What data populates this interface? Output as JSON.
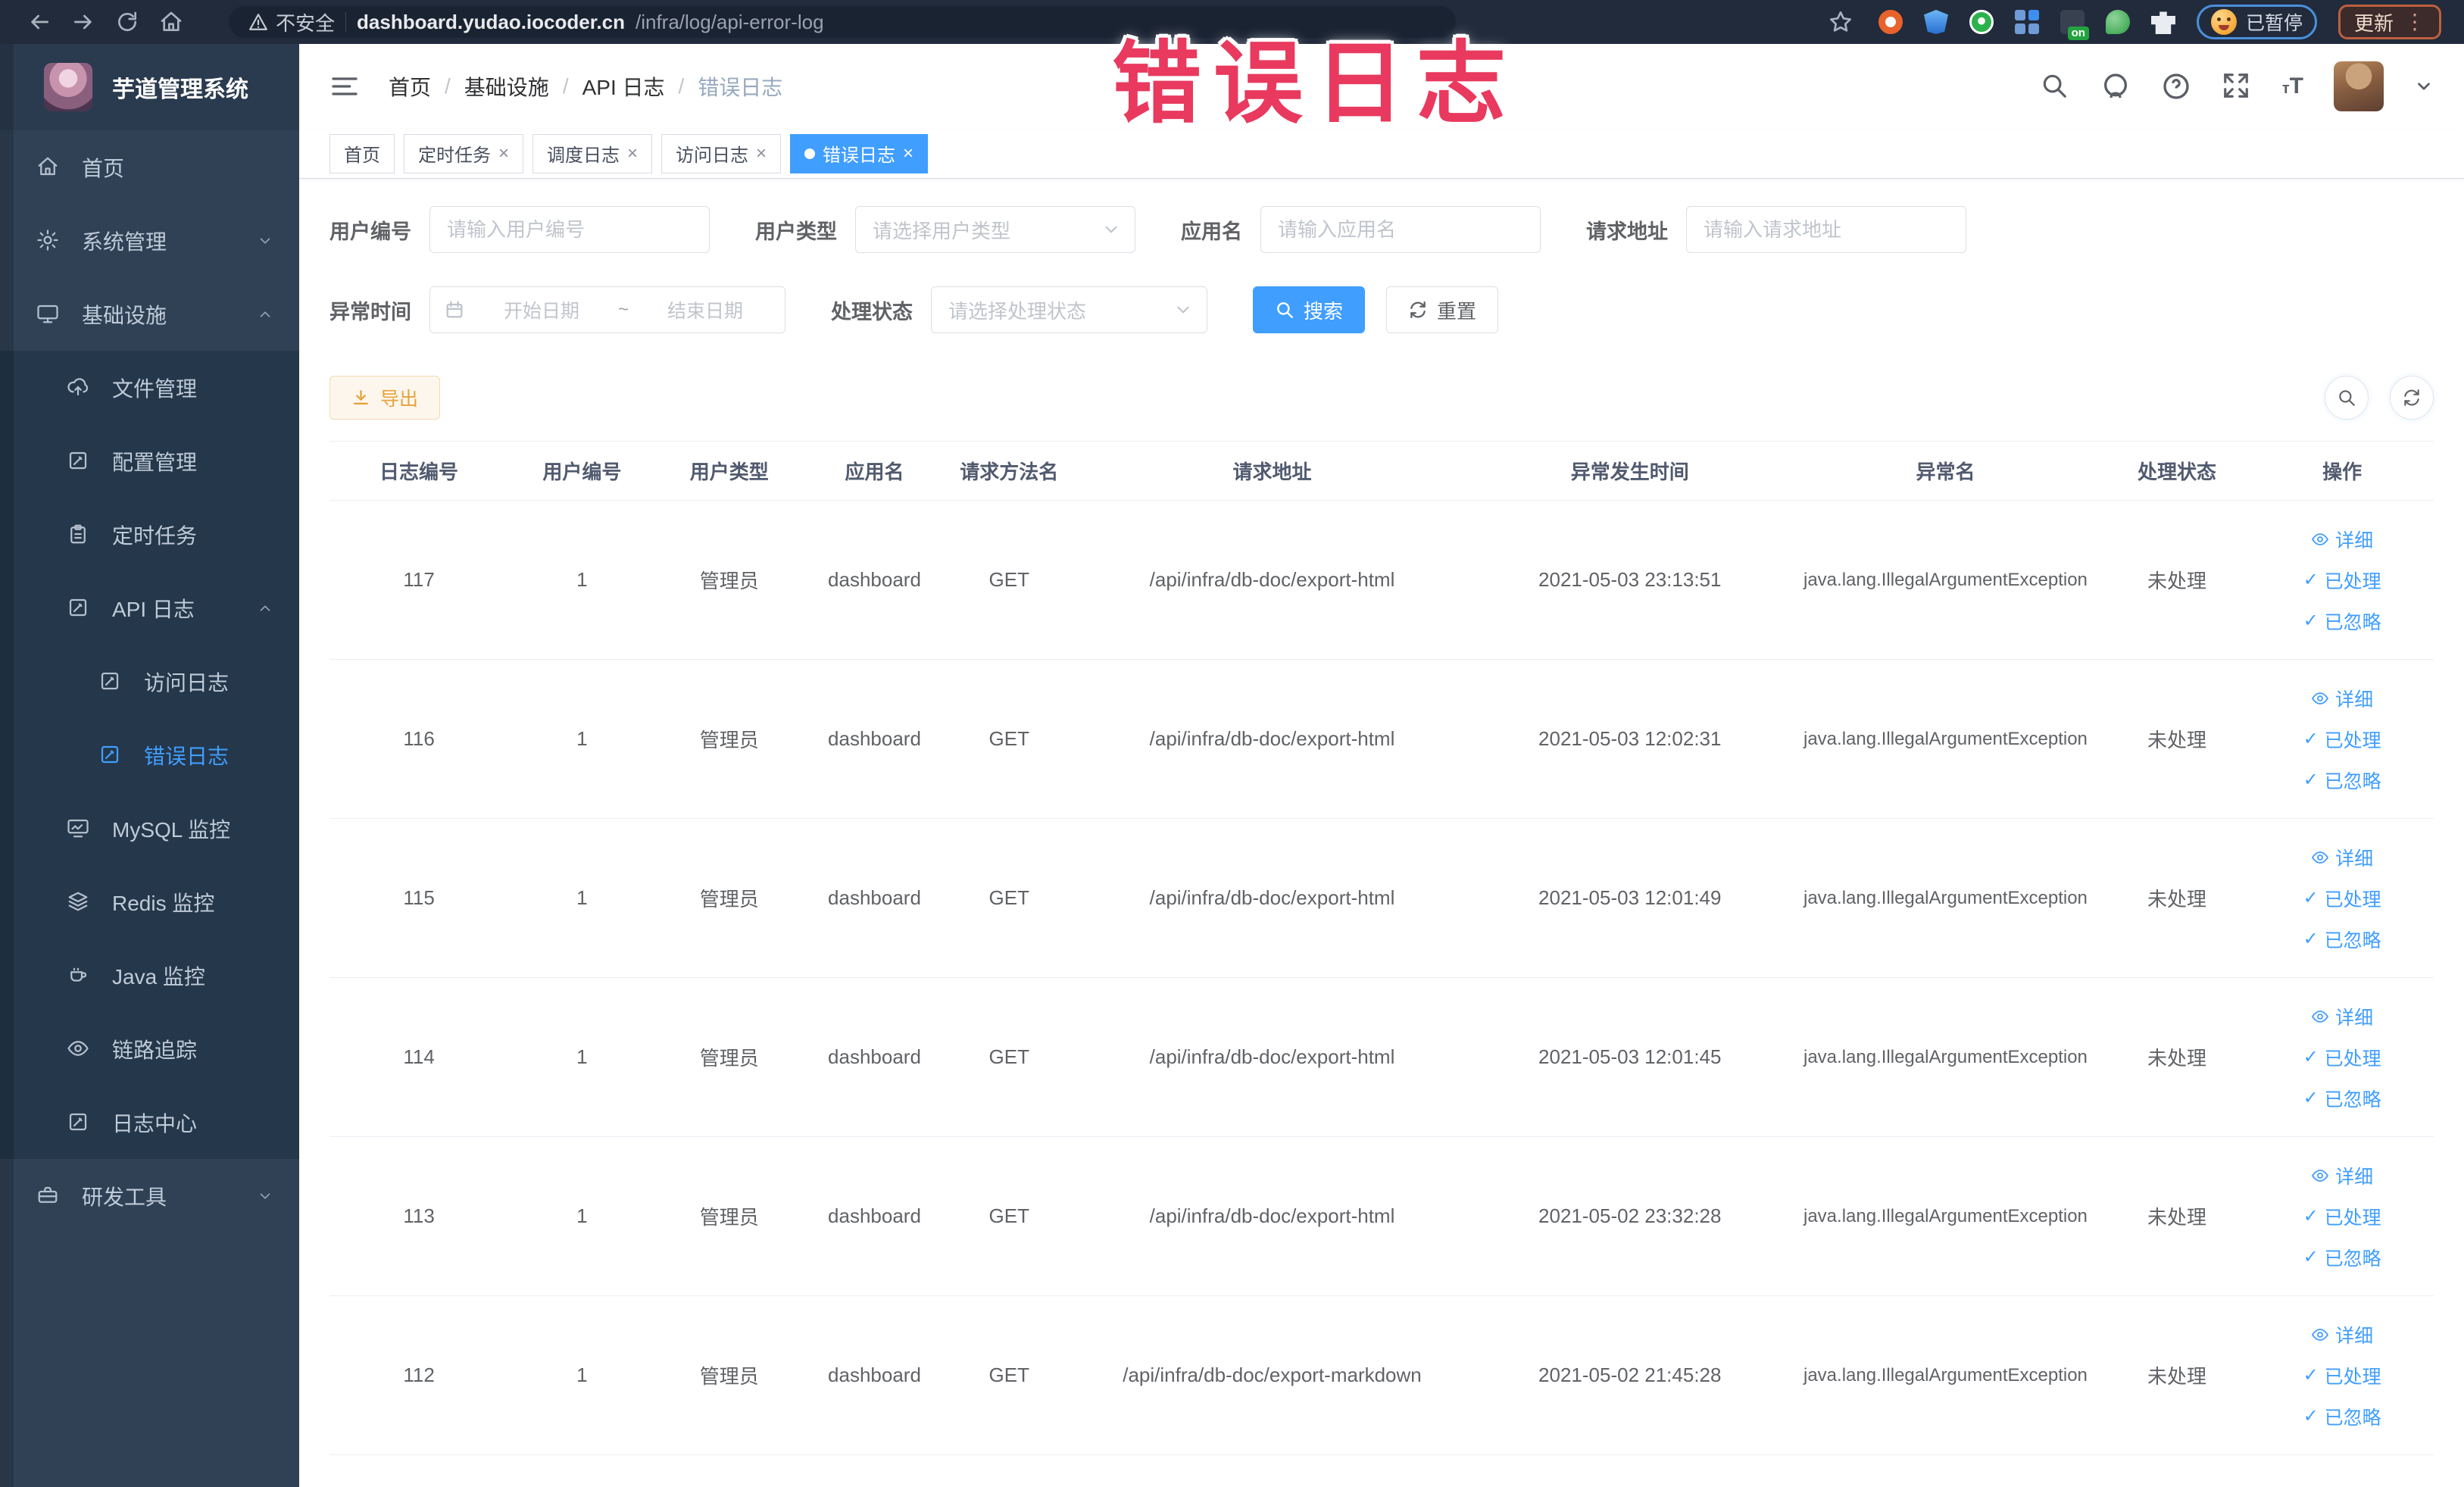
{
  "browser": {
    "security_label": "不安全",
    "url_host": "dashboard.yudao.iocoder.cn",
    "url_path": "/infra/log/api-error-log",
    "paused_label": "已暂停",
    "update_label": "更新"
  },
  "overlay": {
    "text": "错误日志"
  },
  "sidebar": {
    "logo_title": "芋道管理系统",
    "items": [
      {
        "key": "home",
        "label": "首页",
        "icon": "home-icon",
        "level": 0,
        "sub": false,
        "chevron": null,
        "active": false
      },
      {
        "key": "system",
        "label": "系统管理",
        "icon": "gear-icon",
        "level": 0,
        "sub": false,
        "chevron": "down",
        "active": false
      },
      {
        "key": "infra",
        "label": "基础设施",
        "icon": "monitor-icon",
        "level": 0,
        "sub": false,
        "chevron": "up",
        "active": false
      },
      {
        "key": "file",
        "label": "文件管理",
        "icon": "upload-icon",
        "level": 1,
        "sub": true,
        "chevron": null,
        "active": false
      },
      {
        "key": "config",
        "label": "配置管理",
        "icon": "edit-icon",
        "level": 1,
        "sub": true,
        "chevron": null,
        "active": false
      },
      {
        "key": "job",
        "label": "定时任务",
        "icon": "clipboard-icon",
        "level": 1,
        "sub": true,
        "chevron": null,
        "active": false
      },
      {
        "key": "api-log",
        "label": "API 日志",
        "icon": "edit-icon",
        "level": 1,
        "sub": true,
        "chevron": "up",
        "active": false
      },
      {
        "key": "access-log",
        "label": "访问日志",
        "icon": "edit-icon",
        "level": 2,
        "sub": true,
        "chevron": null,
        "active": false
      },
      {
        "key": "error-log",
        "label": "错误日志",
        "icon": "edit-icon",
        "level": 2,
        "sub": true,
        "chevron": null,
        "active": true
      },
      {
        "key": "mysql",
        "label": "MySQL 监控",
        "icon": "chart-icon",
        "level": 1,
        "sub": true,
        "chevron": null,
        "active": false
      },
      {
        "key": "redis",
        "label": "Redis 监控",
        "icon": "layers-icon",
        "level": 1,
        "sub": true,
        "chevron": null,
        "active": false
      },
      {
        "key": "java",
        "label": "Java 监控",
        "icon": "coffee-icon",
        "level": 1,
        "sub": true,
        "chevron": null,
        "active": false
      },
      {
        "key": "tracer",
        "label": "链路追踪",
        "icon": "eye-icon",
        "level": 1,
        "sub": true,
        "chevron": null,
        "active": false
      },
      {
        "key": "log-center",
        "label": "日志中心",
        "icon": "edit-icon",
        "level": 1,
        "sub": true,
        "chevron": null,
        "active": false
      },
      {
        "key": "dev-tools",
        "label": "研发工具",
        "icon": "briefcase-icon",
        "level": 0,
        "sub": false,
        "chevron": "down",
        "active": false
      }
    ]
  },
  "navbar": {
    "breadcrumb": [
      "首页",
      "基础设施",
      "API 日志",
      "错误日志"
    ]
  },
  "tabs": [
    {
      "label": "首页",
      "closable": false,
      "active": false
    },
    {
      "label": "定时任务",
      "closable": true,
      "active": false
    },
    {
      "label": "调度日志",
      "closable": true,
      "active": false
    },
    {
      "label": "访问日志",
      "closable": true,
      "active": false
    },
    {
      "label": "错误日志",
      "closable": true,
      "active": true
    }
  ],
  "filters": {
    "user_id": {
      "label": "用户编号",
      "placeholder": "请输入用户编号"
    },
    "user_type": {
      "label": "用户类型",
      "placeholder": "请选择用户类型"
    },
    "app_name": {
      "label": "应用名",
      "placeholder": "请输入应用名"
    },
    "request_url": {
      "label": "请求地址",
      "placeholder": "请输入请求地址"
    },
    "exception_time": {
      "label": "异常时间",
      "start_placeholder": "开始日期",
      "separator": "~",
      "end_placeholder": "结束日期"
    },
    "process_status": {
      "label": "处理状态",
      "placeholder": "请选择处理状态"
    },
    "search_label": "搜索",
    "reset_label": "重置"
  },
  "toolbar": {
    "export_label": "导出"
  },
  "table": {
    "columns": [
      "日志编号",
      "用户编号",
      "用户类型",
      "应用名",
      "请求方法名",
      "请求地址",
      "异常发生时间",
      "异常名",
      "处理状态",
      "操作"
    ],
    "row_actions": [
      "详细",
      "已处理",
      "已忽略"
    ],
    "rows": [
      {
        "id": "117",
        "user_id": "1",
        "user_type": "管理员",
        "app": "dashboard",
        "method": "GET",
        "url": "/api/infra/db-doc/export-html",
        "time": "2021-05-03 23:13:51",
        "exception": "java.lang.IllegalArgumentException",
        "status": "未处理"
      },
      {
        "id": "116",
        "user_id": "1",
        "user_type": "管理员",
        "app": "dashboard",
        "method": "GET",
        "url": "/api/infra/db-doc/export-html",
        "time": "2021-05-03 12:02:31",
        "exception": "java.lang.IllegalArgumentException",
        "status": "未处理"
      },
      {
        "id": "115",
        "user_id": "1",
        "user_type": "管理员",
        "app": "dashboard",
        "method": "GET",
        "url": "/api/infra/db-doc/export-html",
        "time": "2021-05-03 12:01:49",
        "exception": "java.lang.IllegalArgumentException",
        "status": "未处理"
      },
      {
        "id": "114",
        "user_id": "1",
        "user_type": "管理员",
        "app": "dashboard",
        "method": "GET",
        "url": "/api/infra/db-doc/export-html",
        "time": "2021-05-03 12:01:45",
        "exception": "java.lang.IllegalArgumentException",
        "status": "未处理"
      },
      {
        "id": "113",
        "user_id": "1",
        "user_type": "管理员",
        "app": "dashboard",
        "method": "GET",
        "url": "/api/infra/db-doc/export-html",
        "time": "2021-05-02 23:32:28",
        "exception": "java.lang.IllegalArgumentException",
        "status": "未处理"
      },
      {
        "id": "112",
        "user_id": "1",
        "user_type": "管理员",
        "app": "dashboard",
        "method": "GET",
        "url": "/api/infra/db-doc/export-markdown",
        "time": "2021-05-02 21:45:28",
        "exception": "java.lang.IllegalArgumentException",
        "status": "未处理"
      }
    ]
  },
  "colors": {
    "accent": "#409eff",
    "warning": "#e6a23c",
    "sidebar_bg": "#304156",
    "sidebar_sub_bg": "#25374a",
    "overlay_red": "#e9395e"
  }
}
